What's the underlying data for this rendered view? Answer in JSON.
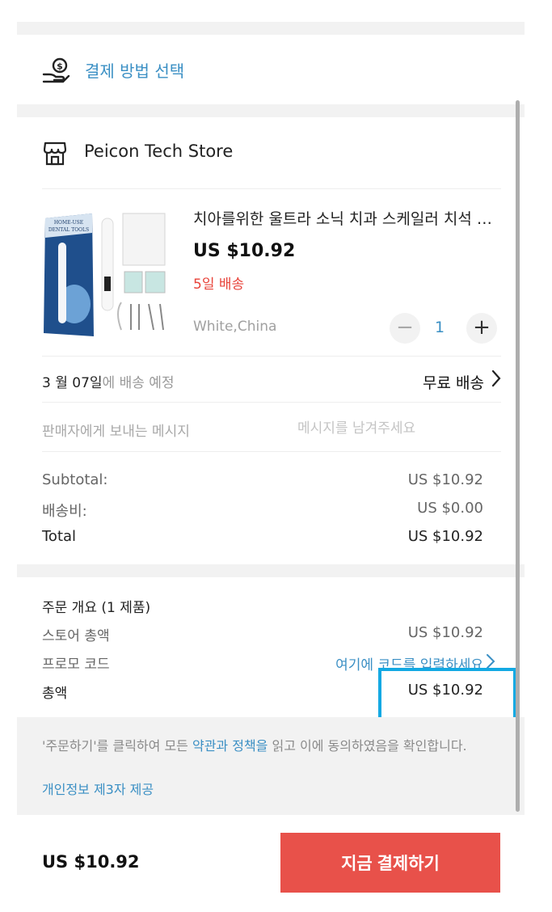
{
  "payment": {
    "label": "결제 방법 선택",
    "icon": "hand-coin-icon"
  },
  "store": {
    "name": "Peicon Tech Store",
    "icon": "store-icon"
  },
  "product": {
    "title": "치아를위한 울트라 소닉 치과 스케일러 치석 제거제 치아 얼룩 치아 미백 치과 치석 제거 클리너",
    "price": "US $10.92",
    "shipping_days": "5일 배송",
    "variant": "White,China",
    "quantity": "1",
    "image_texts": [
      "HOME-USE",
      "DENTAL TOOLS"
    ]
  },
  "delivery": {
    "date": "3 월 07일",
    "date_suffix": "에 배송 예정",
    "method": "무료 배송"
  },
  "message": {
    "label": "판매자에게 보내는 메시지",
    "placeholder": "메시지를 남겨주세요"
  },
  "store_summary": [
    {
      "label": "Subtotal:",
      "value": "US $10.92"
    },
    {
      "label": "배송비:",
      "value": "US $0.00"
    },
    {
      "label": "Total",
      "value": "US $10.92"
    }
  ],
  "order_summary": {
    "title": "주문 개요 (1 제품)",
    "store_total_label": "스토어 총액",
    "store_total_value": "US $10.92",
    "promo_label": "프로모 코드",
    "promo_link": "여기에 코드를 입력하세요",
    "total_label": "총액",
    "total_value": "US $10.92"
  },
  "terms": {
    "prefix": "'주문하기'를 클릭하여 모든 ",
    "link": "약관과 정책을",
    "suffix": " 읽고 이에 동의하였음을 확인합니다.",
    "privacy": "개인정보 제3자 제공"
  },
  "footer": {
    "total": "US $10.92",
    "pay_button": "지금 결제하기"
  },
  "colors": {
    "accent_blue": "#3a8fc4",
    "red": "#e8433a",
    "button": "#e8514a",
    "highlight": "#13a9e3"
  }
}
